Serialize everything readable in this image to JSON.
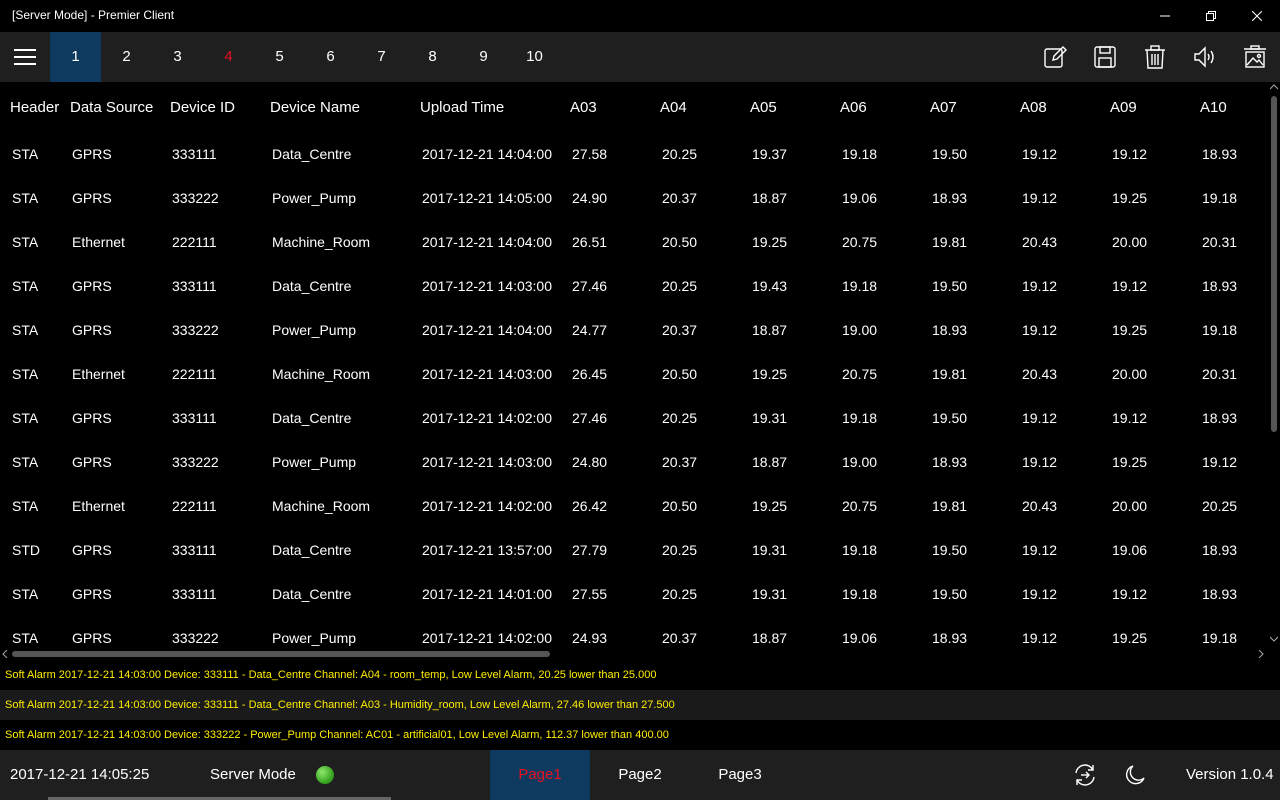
{
  "window": {
    "title": "[Server Mode] - Premier Client"
  },
  "toolbar": {
    "pages": [
      {
        "label": "1",
        "active": true,
        "alert": false
      },
      {
        "label": "2",
        "active": false,
        "alert": false
      },
      {
        "label": "3",
        "active": false,
        "alert": false
      },
      {
        "label": "4",
        "active": false,
        "alert": true
      },
      {
        "label": "5",
        "active": false,
        "alert": false
      },
      {
        "label": "6",
        "active": false,
        "alert": false
      },
      {
        "label": "7",
        "active": false,
        "alert": false
      },
      {
        "label": "8",
        "active": false,
        "alert": false
      },
      {
        "label": "9",
        "active": false,
        "alert": false
      },
      {
        "label": "10",
        "active": false,
        "alert": false
      }
    ],
    "tools": [
      "edit-icon",
      "save-icon",
      "delete-icon",
      "volume-icon",
      "clear-all-icon"
    ]
  },
  "table": {
    "columns": [
      "Header",
      "Data Source",
      "Device ID",
      "Device Name",
      "Upload Time",
      "A03",
      "A04",
      "A05",
      "A06",
      "A07",
      "A08",
      "A09",
      "A10"
    ],
    "rows": [
      [
        "STA",
        "GPRS",
        "333111",
        "Data_Centre",
        "2017-12-21 14:04:00",
        "27.58",
        "20.25",
        "19.37",
        "19.18",
        "19.50",
        "19.12",
        "19.12",
        "18.93"
      ],
      [
        "STA",
        "GPRS",
        "333222",
        "Power_Pump",
        "2017-12-21 14:05:00",
        "24.90",
        "20.37",
        "18.87",
        "19.06",
        "18.93",
        "19.12",
        "19.25",
        "19.18"
      ],
      [
        "STA",
        "Ethernet",
        "222111",
        "Machine_Room",
        "2017-12-21 14:04:00",
        "26.51",
        "20.50",
        "19.25",
        "20.75",
        "19.81",
        "20.43",
        "20.00",
        "20.31"
      ],
      [
        "STA",
        "GPRS",
        "333111",
        "Data_Centre",
        "2017-12-21 14:03:00",
        "27.46",
        "20.25",
        "19.43",
        "19.18",
        "19.50",
        "19.12",
        "19.12",
        "18.93"
      ],
      [
        "STA",
        "GPRS",
        "333222",
        "Power_Pump",
        "2017-12-21 14:04:00",
        "24.77",
        "20.37",
        "18.87",
        "19.00",
        "18.93",
        "19.12",
        "19.25",
        "19.18"
      ],
      [
        "STA",
        "Ethernet",
        "222111",
        "Machine_Room",
        "2017-12-21 14:03:00",
        "26.45",
        "20.50",
        "19.25",
        "20.75",
        "19.81",
        "20.43",
        "20.00",
        "20.31"
      ],
      [
        "STA",
        "GPRS",
        "333111",
        "Data_Centre",
        "2017-12-21 14:02:00",
        "27.46",
        "20.25",
        "19.31",
        "19.18",
        "19.50",
        "19.12",
        "19.12",
        "18.93"
      ],
      [
        "STA",
        "GPRS",
        "333222",
        "Power_Pump",
        "2017-12-21 14:03:00",
        "24.80",
        "20.37",
        "18.87",
        "19.00",
        "18.93",
        "19.12",
        "19.25",
        "19.12"
      ],
      [
        "STA",
        "Ethernet",
        "222111",
        "Machine_Room",
        "2017-12-21 14:02:00",
        "26.42",
        "20.50",
        "19.25",
        "20.75",
        "19.81",
        "20.43",
        "20.00",
        "20.25"
      ],
      [
        "STD",
        "GPRS",
        "333111",
        "Data_Centre",
        "2017-12-21 13:57:00",
        "27.79",
        "20.25",
        "19.31",
        "19.18",
        "19.50",
        "19.12",
        "19.06",
        "18.93"
      ],
      [
        "STA",
        "GPRS",
        "333111",
        "Data_Centre",
        "2017-12-21 14:01:00",
        "27.55",
        "20.25",
        "19.31",
        "19.18",
        "19.50",
        "19.12",
        "19.12",
        "18.93"
      ],
      [
        "STA",
        "GPRS",
        "333222",
        "Power_Pump",
        "2017-12-21 14:02:00",
        "24.93",
        "20.37",
        "18.87",
        "19.06",
        "18.93",
        "19.12",
        "19.25",
        "19.18"
      ]
    ]
  },
  "alarms": [
    "Soft Alarm 2017-12-21 14:03:00 Device: 333111 - Data_Centre Channel: A04 - room_temp, Low Level Alarm, 20.25 lower than 25.000",
    "Soft Alarm 2017-12-21 14:03:00 Device: 333111 - Data_Centre Channel: A03 - Humidity_room, Low Level Alarm, 27.46 lower than 27.500",
    "Soft Alarm 2017-12-21 14:03:00 Device: 333222 - Power_Pump Channel: AC01 - artificial01, Low Level Alarm, 112.37 lower than 400.00"
  ],
  "status": {
    "datetime": "2017-12-21 14:05:25",
    "mode": "Server Mode",
    "version": "Version 1.0.4",
    "tabs": [
      {
        "label": "Page1",
        "active": true
      },
      {
        "label": "Page2",
        "active": false
      },
      {
        "label": "Page3",
        "active": false
      }
    ]
  },
  "colors": {
    "accent": "#0e3a5f",
    "alert": "#e81123",
    "alarm_text": "#ffee00",
    "status_ok": "#3cb521"
  }
}
